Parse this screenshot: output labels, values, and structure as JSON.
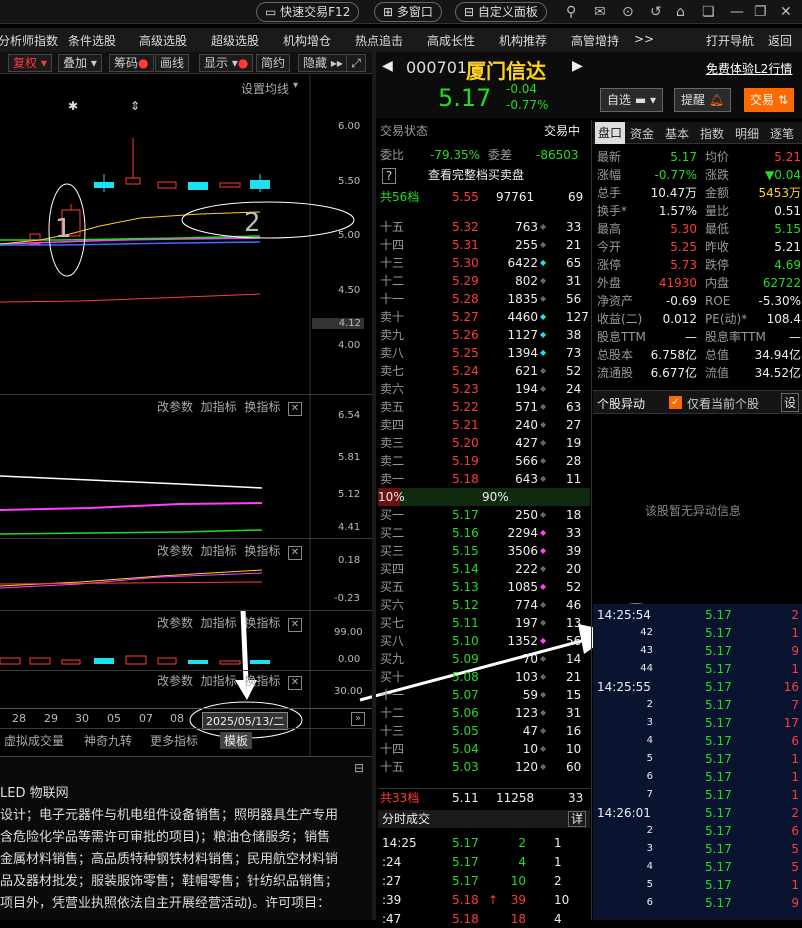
{
  "topbar": {
    "quick_trade": "快速交易F12",
    "multi_window": "多窗口",
    "custom_panel": "自定义面板"
  },
  "menu": [
    "分析师指数",
    "条件选股",
    "高级选股",
    "超级选股",
    "机构增仓",
    "热点追击",
    "高成长性",
    "机构推荐",
    "高管增持",
    ">>",
    "打开导航",
    "返回"
  ],
  "toolbar": {
    "restore": "复权",
    "overlay": "叠加",
    "chips": "筹码",
    "draw": "画线",
    "display": "显示",
    "simple": "简约",
    "hide": "隐藏",
    "ma_setting": "设置均线"
  },
  "stock": {
    "code": "000701",
    "name": "厦门信达",
    "price": "5.17",
    "change": "-0.04",
    "pct": "-0.77%",
    "free_l2": "免费体验L2行情",
    "watch": "自选",
    "alert": "提醒",
    "trade": "交易"
  },
  "chart_axes": {
    "main": [
      "6.00",
      "5.50",
      "5.00",
      "4.50",
      "4.12",
      "4.00"
    ],
    "ind1": [
      "6.54",
      "5.81",
      "5.12",
      "4.41"
    ],
    "ind2": [
      "0.18",
      "-0.23"
    ],
    "ind3": [
      "99.00",
      "0.00"
    ],
    "ind4": [
      "30.00"
    ]
  },
  "panel_ctrls": {
    "params": "改参数",
    "add": "加指标",
    "swap": "换指标"
  },
  "dates": [
    "28",
    "29",
    "30",
    "05",
    "07",
    "08"
  ],
  "cursor_date": "2025/05/13/二",
  "bottom_tabs": [
    "虚拟成交量",
    "神奇九转",
    "更多指标",
    "模板"
  ],
  "annotations": {
    "one": "1",
    "two": "2"
  },
  "company": {
    "line1": "LED 物联网",
    "line2": "设计；电子元器件与机电组件设备销售；照明器具生产专用",
    "line3": "含危险化学品等需许可审批的项目)；粮油仓储服务；销售",
    "line4": "金属材料销售；高品质特种钢铁材料销售；民用航空材料销",
    "line5": "品及器材批发；服装服饰零售；鞋帽零售；针纺织品销售；",
    "line6": "项目外，凭营业执照依法自主开展经营活动)。许可项目："
  },
  "ob_header": {
    "status_label": "交易状态",
    "status": "交易中",
    "ratio_label": "委比",
    "ratio": "-79.35%",
    "diff_label": "委差",
    "diff": "-86503",
    "full_link": "查看完整档买卖盘",
    "q": "?"
  },
  "ob_sell_total": {
    "label": "共56档",
    "price": "5.55",
    "vol": "97761",
    "cnt": "69"
  },
  "ob_sell": [
    {
      "l": "十五",
      "p": "5.32",
      "v": "763",
      "c": "33"
    },
    {
      "l": "十四",
      "p": "5.31",
      "v": "255",
      "c": "21"
    },
    {
      "l": "十三",
      "p": "5.30",
      "v": "6422",
      "c": "65"
    },
    {
      "l": "十二",
      "p": "5.29",
      "v": "802",
      "c": "31"
    },
    {
      "l": "十一",
      "p": "5.28",
      "v": "1835",
      "c": "56"
    },
    {
      "l": "卖十",
      "p": "5.27",
      "v": "4460",
      "c": "127"
    },
    {
      "l": "卖九",
      "p": "5.26",
      "v": "1127",
      "c": "38"
    },
    {
      "l": "卖八",
      "p": "5.25",
      "v": "1394",
      "c": "73"
    },
    {
      "l": "卖七",
      "p": "5.24",
      "v": "621",
      "c": "52"
    },
    {
      "l": "卖六",
      "p": "5.23",
      "v": "194",
      "c": "24"
    },
    {
      "l": "卖五",
      "p": "5.22",
      "v": "571",
      "c": "63"
    },
    {
      "l": "卖四",
      "p": "5.21",
      "v": "240",
      "c": "27"
    },
    {
      "l": "卖三",
      "p": "5.20",
      "v": "427",
      "c": "19"
    },
    {
      "l": "卖二",
      "p": "5.19",
      "v": "566",
      "c": "28"
    },
    {
      "l": "卖一",
      "p": "5.18",
      "v": "643",
      "c": "11"
    }
  ],
  "ob_ratio": {
    "left": "10%",
    "right": "90%"
  },
  "ob_buy": [
    {
      "l": "买一",
      "p": "5.17",
      "v": "250",
      "c": "18"
    },
    {
      "l": "买二",
      "p": "5.16",
      "v": "2294",
      "c": "33"
    },
    {
      "l": "买三",
      "p": "5.15",
      "v": "3506",
      "c": "39"
    },
    {
      "l": "买四",
      "p": "5.14",
      "v": "222",
      "c": "20"
    },
    {
      "l": "买五",
      "p": "5.13",
      "v": "1085",
      "c": "52"
    },
    {
      "l": "买六",
      "p": "5.12",
      "v": "774",
      "c": "46"
    },
    {
      "l": "买七",
      "p": "5.11",
      "v": "197",
      "c": "13"
    },
    {
      "l": "买八",
      "p": "5.10",
      "v": "1352",
      "c": "56"
    },
    {
      "l": "买九",
      "p": "5.09",
      "v": "70",
      "c": "14"
    },
    {
      "l": "买十",
      "p": "5.08",
      "v": "103",
      "c": "21"
    },
    {
      "l": "十一",
      "p": "5.07",
      "v": "59",
      "c": "15"
    },
    {
      "l": "十二",
      "p": "5.06",
      "v": "123",
      "c": "31"
    },
    {
      "l": "十三",
      "p": "5.05",
      "v": "47",
      "c": "16"
    },
    {
      "l": "十四",
      "p": "5.04",
      "v": "10",
      "c": "10"
    },
    {
      "l": "十五",
      "p": "5.03",
      "v": "120",
      "c": "60"
    }
  ],
  "ob_buy_total": {
    "label": "共33档",
    "price": "5.11",
    "vol": "11258",
    "cnt": "33"
  },
  "tick_hdr": {
    "title": "分时成交",
    "detail": "详"
  },
  "ticks_bottom": [
    {
      "t": "14:25",
      "p": "5.17",
      "v": "2",
      "c": "1"
    },
    {
      "t": ":24",
      "p": "5.17",
      "v": "4",
      "c": "1"
    },
    {
      "t": ":27",
      "p": "5.17",
      "v": "10",
      "c": "2"
    },
    {
      "t": ":39",
      "p": "5.18",
      "v": "39",
      "c": "10"
    },
    {
      "t": ":47",
      "p": "5.18",
      "v": "18",
      "c": "4"
    }
  ],
  "tabs_r": [
    "盘口",
    "资金",
    "基本",
    "指数",
    "明细",
    "逐笔"
  ],
  "pankou": [
    [
      "最新",
      "5.17",
      "均价",
      "5.21"
    ],
    [
      "涨幅",
      "-0.77%",
      "涨跌",
      "▼0.04"
    ],
    [
      "总手",
      "10.47万",
      "金额",
      "5453万"
    ],
    [
      "换手*",
      "1.57%",
      "量比",
      "0.51"
    ],
    [
      "最高",
      "5.30",
      "最低",
      "5.15"
    ],
    [
      "今开",
      "5.25",
      "昨收",
      "5.21"
    ],
    [
      "涨停",
      "5.73",
      "跌停",
      "4.69"
    ],
    [
      "外盘",
      "41930",
      "内盘",
      "62722"
    ],
    [
      "净资产",
      "-0.69",
      "ROE",
      "-5.30%"
    ],
    [
      "收益(二)",
      "0.012",
      "PE(动)*",
      "108.4"
    ],
    [
      "股息TTM",
      "—",
      "股息率TTM",
      "—"
    ],
    [
      "总股本",
      "6.758亿",
      "总值",
      "34.94亿"
    ],
    [
      "流通股",
      "6.677亿",
      "流值",
      "34.52亿"
    ]
  ],
  "anomaly": {
    "title": "个股异动",
    "only_current": "仅看当前个股",
    "settings": "设",
    "empty": "该股暂无异动信息"
  },
  "ticks_right": [
    {
      "t": "14:25:54",
      "p": "5.17",
      "v": "2"
    },
    {
      "t": "42",
      "p": "5.17",
      "v": "1"
    },
    {
      "t": "43",
      "p": "5.17",
      "v": "9"
    },
    {
      "t": "44",
      "p": "5.17",
      "v": "1"
    },
    {
      "t": "14:25:55",
      "p": "5.17",
      "v": "16"
    },
    {
      "t": "2",
      "p": "5.17",
      "v": "7"
    },
    {
      "t": "3",
      "p": "5.17",
      "v": "17"
    },
    {
      "t": "4",
      "p": "5.17",
      "v": "6"
    },
    {
      "t": "5",
      "p": "5.17",
      "v": "1"
    },
    {
      "t": "6",
      "p": "5.17",
      "v": "1"
    },
    {
      "t": "7",
      "p": "5.17",
      "v": "1"
    },
    {
      "t": "14:26:01",
      "p": "5.17",
      "v": "2"
    },
    {
      "t": "2",
      "p": "5.17",
      "v": "6"
    },
    {
      "t": "3",
      "p": "5.17",
      "v": "5"
    },
    {
      "t": "4",
      "p": "5.17",
      "v": "5"
    },
    {
      "t": "5",
      "p": "5.17",
      "v": "1"
    },
    {
      "t": "6",
      "p": "5.17",
      "v": "9"
    }
  ],
  "colors": {
    "up": "#ff3b3b",
    "down": "#22dd22",
    "accent": "#ff6a00",
    "cyan": "#1ee0f0"
  }
}
